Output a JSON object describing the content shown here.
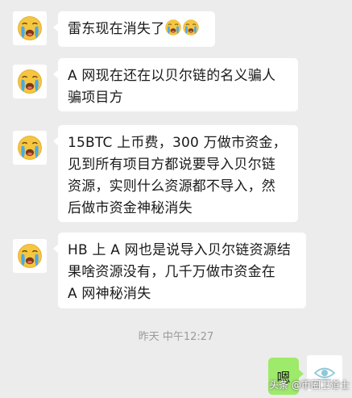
{
  "chat": {
    "messages": [
      {
        "sender_avatar": "crying-face-emoji",
        "text": "雷东现在消失了"
      },
      {
        "sender_avatar": "crying-face-emoji",
        "line1": "A 网现在还在以贝尔链的名义骗人",
        "line2": "骗项目方"
      },
      {
        "sender_avatar": "crying-face-emoji",
        "line1": "15BTC 上币费，300 万做市资金，",
        "line2": "见到所有项目方都说要导入贝尔链",
        "line3": "资源，实则什么资源都不导入，然",
        "line4": "后做市资金神秘消失"
      },
      {
        "sender_avatar": "crying-face-emoji",
        "line1": "HB 上 A 网也是说导入贝尔链资源结",
        "line2": "果啥资源没有，几千万做市资金在",
        "line3": "A 网神秘消失"
      }
    ],
    "timestamp": "昨天 中午12:27",
    "self_message": {
      "text": "嗯",
      "bubble_color": "#9eea6a"
    }
  },
  "watermark": "头条 @币圈卫道士",
  "colors": {
    "background": "#ececec",
    "bubble": "#ffffff",
    "emoji": "#f6c640"
  }
}
